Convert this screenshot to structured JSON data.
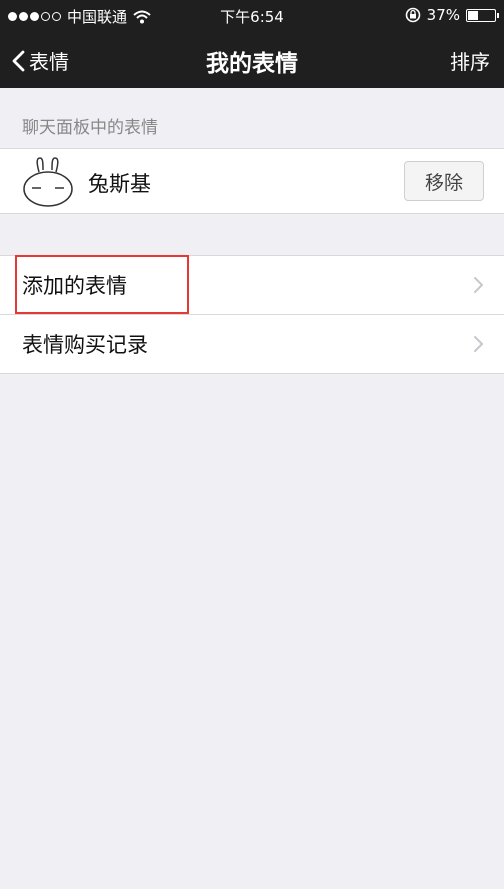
{
  "status_bar": {
    "carrier": "中国联通",
    "time": "下午6:54",
    "battery": "37%",
    "battery_level": 0.37,
    "icons": [
      "signal-dots-icon",
      "wifi-icon",
      "rotation-lock-icon",
      "battery-icon"
    ]
  },
  "nav": {
    "back_label": "表情",
    "title": "我的表情",
    "right_label": "排序"
  },
  "section": {
    "header": "聊天面板中的表情"
  },
  "sticker": {
    "name": "兔斯基",
    "remove_label": "移除"
  },
  "menu": [
    {
      "label": "添加的表情"
    },
    {
      "label": "表情购买记录"
    }
  ],
  "colors": {
    "bar": "#1f1f1f",
    "background": "#efeff4",
    "highlight": "#e53935"
  }
}
